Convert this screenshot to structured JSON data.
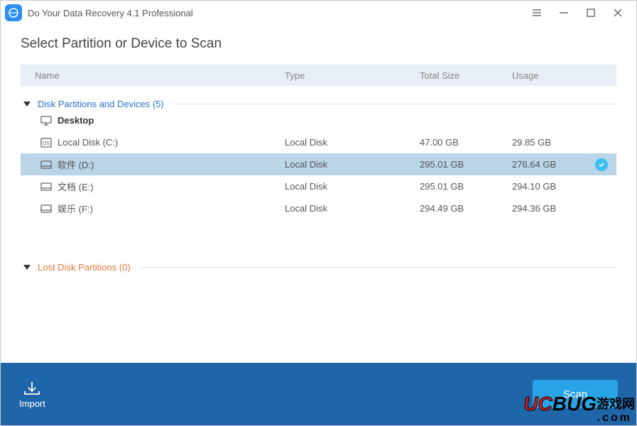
{
  "app_title": "Do Your Data Recovery 4.1 Professional",
  "page_title": "Select Partition or Device to Scan",
  "columns": {
    "name": "Name",
    "type": "Type",
    "total": "Total Size",
    "usage": "Usage"
  },
  "sections": {
    "disks": {
      "label": "Disk Partitions and Devices (5)"
    },
    "lost": {
      "label": "Lost Disk Partitions (0)"
    }
  },
  "rows": [
    {
      "icon": "monitor",
      "name": "Desktop",
      "type": "",
      "total": "",
      "usage": "",
      "header": true,
      "selected": false
    },
    {
      "icon": "os-disk",
      "name": "Local Disk (C:)",
      "type": "Local Disk",
      "total": "47.00 GB",
      "usage": "29.85 GB",
      "header": false,
      "selected": false
    },
    {
      "icon": "disk",
      "name": "软件 (D:)",
      "type": "Local Disk",
      "total": "295.01 GB",
      "usage": "276.64 GB",
      "header": false,
      "selected": true
    },
    {
      "icon": "disk",
      "name": "文档 (E:)",
      "type": "Local Disk",
      "total": "295.01 GB",
      "usage": "294.10 GB",
      "header": false,
      "selected": false
    },
    {
      "icon": "disk",
      "name": "娱乐 (F:)",
      "type": "Local Disk",
      "total": "294.49 GB",
      "usage": "294.36 GB",
      "header": false,
      "selected": false
    }
  ],
  "footer": {
    "import": "Import",
    "scan": "Scan"
  },
  "watermark": {
    "brand_red": "UC",
    "brand_black": "BUG",
    "brand_cn": "游戏网",
    "url": ".com"
  }
}
